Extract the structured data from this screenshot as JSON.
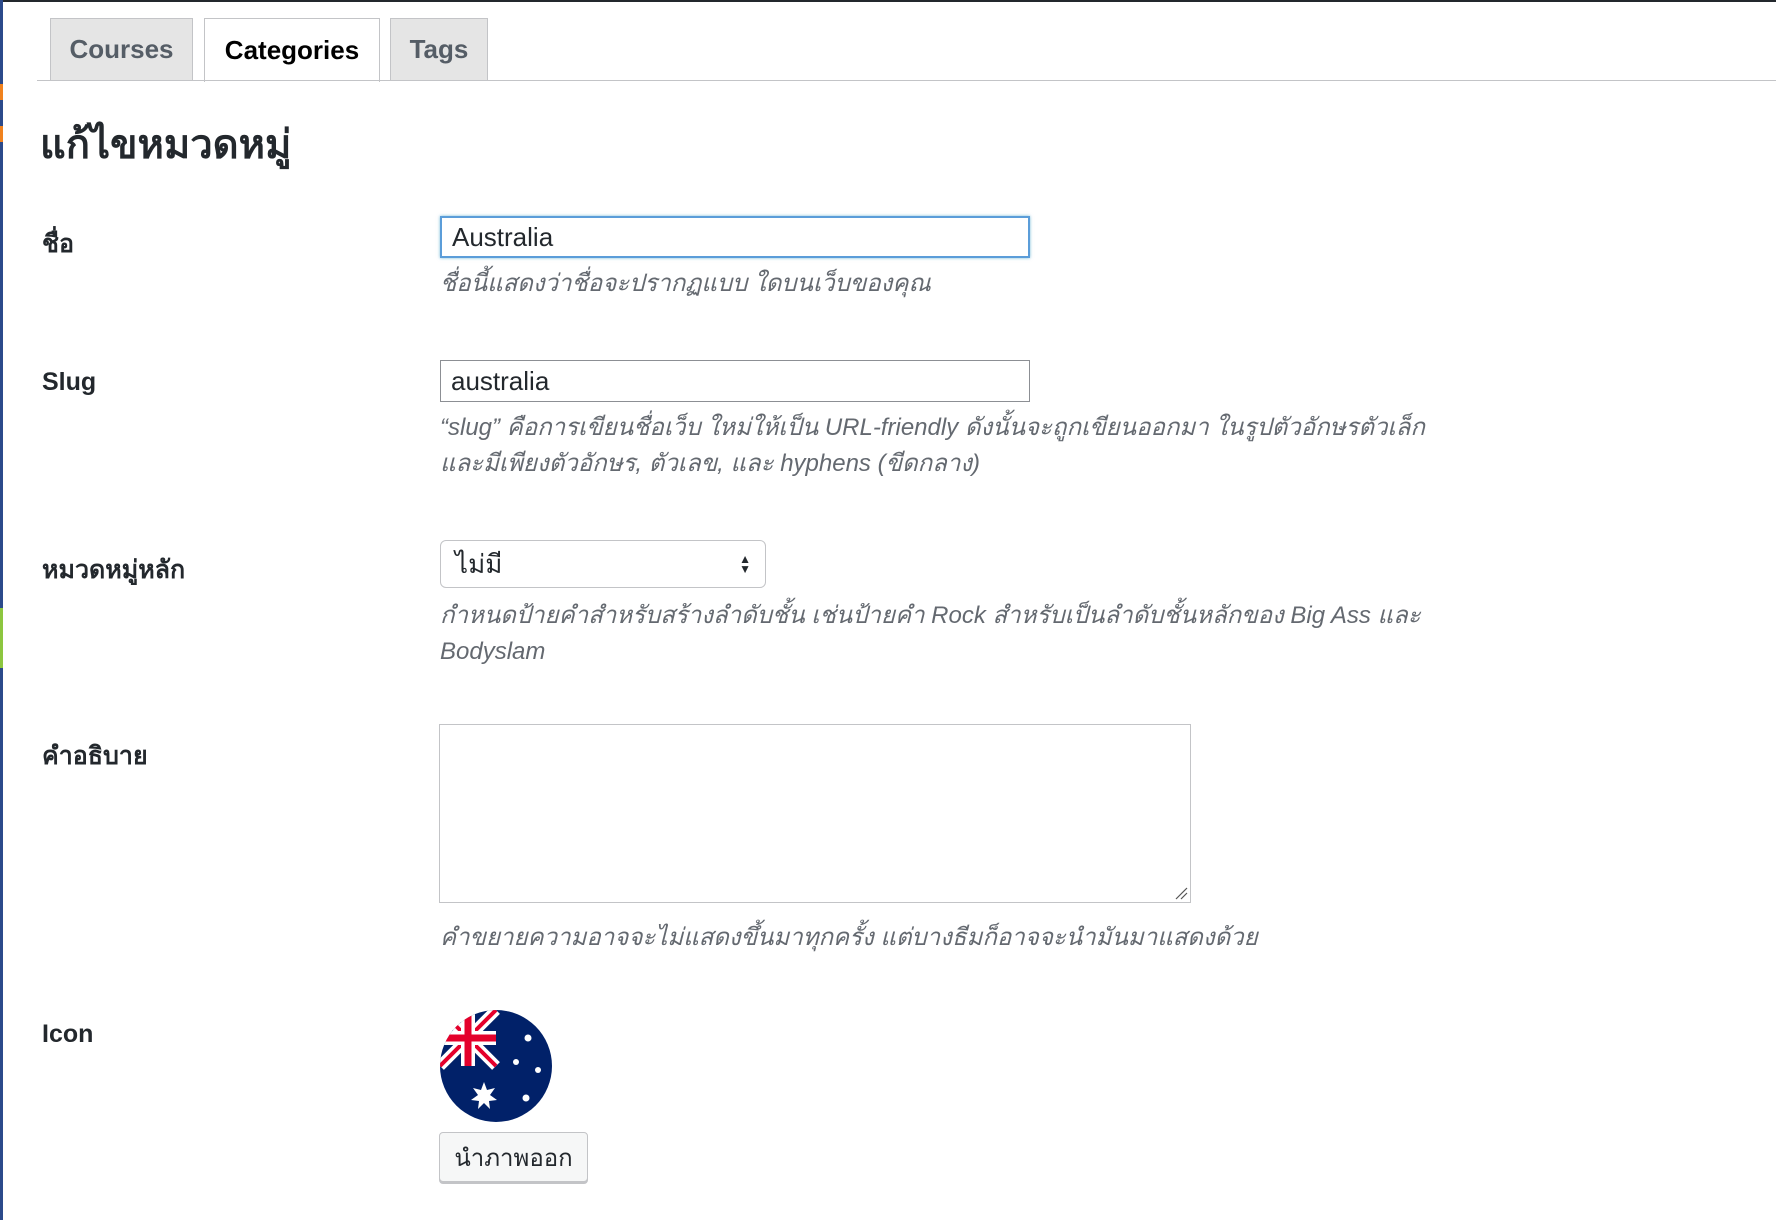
{
  "tabs": [
    {
      "label": "Courses",
      "active": false
    },
    {
      "label": "Categories",
      "active": true
    },
    {
      "label": "Tags",
      "active": false
    }
  ],
  "page_title": "แก้ไขหมวดหมู่",
  "fields": {
    "name": {
      "label": "ชื่อ",
      "value": "Australia",
      "hint": "ชื่อนี้แสดงว่าชื่อจะปรากฏแบบ ใดบนเว็บของคุณ"
    },
    "slug": {
      "label": "Slug",
      "value": "australia",
      "hint_line1": "“slug” คือการเขียนชื่อเว็บ ใหม่ให้เป็น URL-friendly ดังนั้นจะถูกเขียนออกมา ในรูปตัวอักษรตัวเล็ก",
      "hint_line2": "และมีเพียงตัวอักษร, ตัวเลข, และ hyphens (ขีดกลาง)"
    },
    "parent": {
      "label": "หมวดหมู่หลัก",
      "selected": "ไม่มี",
      "hint_line1": "กำหนดป้ายคำสำหรับสร้างลำดับชั้น เช่นป้ายคำ Rock สำหรับเป็นลำดับชั้นหลักของ Big Ass และ",
      "hint_line2": "Bodyslam"
    },
    "description": {
      "label": "คำอธิบาย",
      "value": "",
      "hint": "คำขยายความอาจจะไม่แสดงขึ้นมาทุกครั้ง แต่บางธีมก็อาจจะนำมันมาแสดงด้วย"
    },
    "icon": {
      "label": "Icon",
      "image": "australia-flag-icon",
      "remove_button": "นำภาพออก"
    }
  },
  "colors": {
    "focus_border": "#5b9dd9",
    "admin_sidebar": "#2b4a8b",
    "flag_blue": "#012169",
    "flag_red": "#e4002b"
  }
}
